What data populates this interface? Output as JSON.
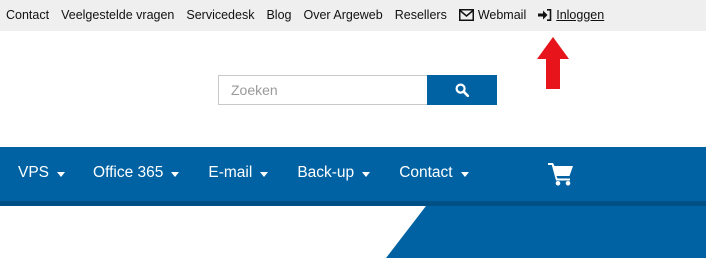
{
  "topbar": {
    "links": [
      {
        "label": "Contact"
      },
      {
        "label": "Veelgestelde vragen"
      },
      {
        "label": "Servicedesk"
      },
      {
        "label": "Blog"
      },
      {
        "label": "Over Argeweb"
      },
      {
        "label": "Resellers"
      },
      {
        "label": "Webmail",
        "icon": "envelope-icon"
      },
      {
        "label": "Inloggen",
        "icon": "sign-in-icon"
      }
    ]
  },
  "annotation": {
    "icon": "red-arrow-up-icon",
    "color": "#e8141b"
  },
  "search": {
    "placeholder": "Zoeken",
    "button_icon": "search-icon"
  },
  "nav": {
    "items": [
      {
        "label": "VPS"
      },
      {
        "label": "Office 365"
      },
      {
        "label": "E-mail"
      },
      {
        "label": "Back-up"
      },
      {
        "label": "Contact"
      }
    ],
    "cart_icon": "shopping-cart-icon"
  },
  "colors": {
    "brand_blue": "#0062a3",
    "dark_blue": "#004f85",
    "topbar_bg": "#efefef"
  }
}
